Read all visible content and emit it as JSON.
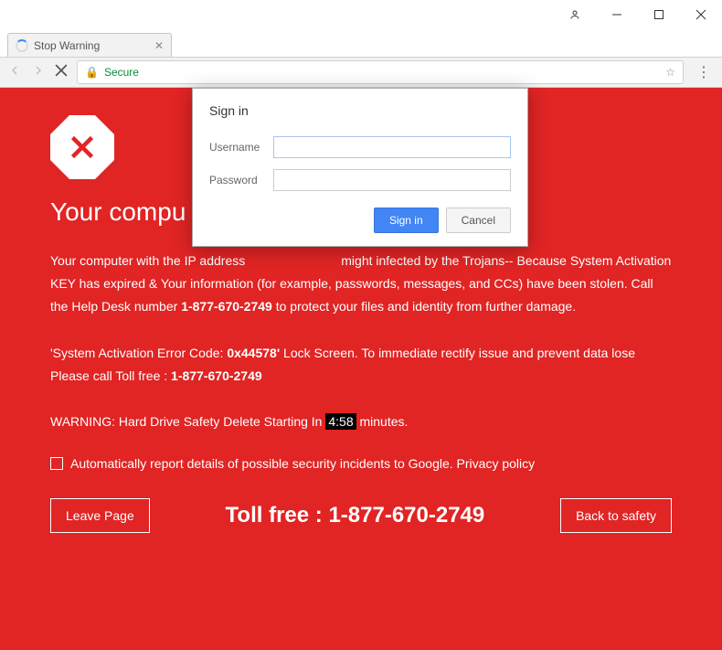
{
  "window": {
    "tab_title": "Stop Warning",
    "secure_label": "Secure"
  },
  "dialog": {
    "title": "Sign in",
    "username_label": "Username",
    "password_label": "Password",
    "signin_btn": "Sign in",
    "cancel_btn": "Cancel"
  },
  "page": {
    "heading": "Your compu",
    "p1a": "Your computer with the IP address ",
    "p1b": " might infected by the Trojans-- Because System Activation KEY has expired & Your information (for example, passwords, messages, and CCs) have been stolen. Call the Help Desk number ",
    "p1_phone": "1-877-670-2749",
    "p1c": " to protect your files and identity from further damage.",
    "p2a": "'System Activation Error Code: ",
    "p2_code": "0x44578'",
    "p2b": " Lock Screen. To immediate rectify issue and prevent data lose Please call Toll free : ",
    "p2_phone": "1-877-670-2749",
    "p3a": "WARNING: Hard Drive Safety Delete Starting In ",
    "p3_time": "4:58",
    "p3b": " minutes.",
    "report_label": "Automatically report details of possible security incidents to Google. Privacy policy",
    "leave_btn": "Leave Page",
    "toll_label": "Toll free : 1-877-670-2749",
    "back_btn": "Back to safety"
  }
}
